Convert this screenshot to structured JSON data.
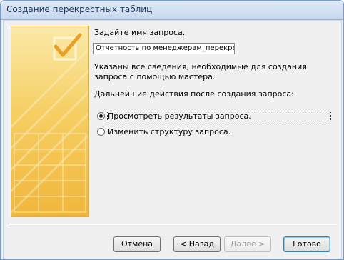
{
  "window": {
    "title": "Создание перекрестных таблиц"
  },
  "form": {
    "prompt": "Задайте имя запроса.",
    "query_name": "Отчетность по менеджерам_перекрестный",
    "info_text": "Указаны все сведения, необходимые для создания запроса с помощью мастера.",
    "next_actions_label": "Дальнейшие действия после создания запроса:"
  },
  "options": [
    {
      "label": "Просмотреть результаты запроса.",
      "selected": true
    },
    {
      "label": "Изменить структуру запроса.",
      "selected": false
    }
  ],
  "buttons": {
    "cancel": "Отмена",
    "back": "< Назад",
    "next": "Далее >",
    "finish": "Готово"
  },
  "colors": {
    "art_yellow": "#f6cf64",
    "title_text": "#1e395b"
  }
}
